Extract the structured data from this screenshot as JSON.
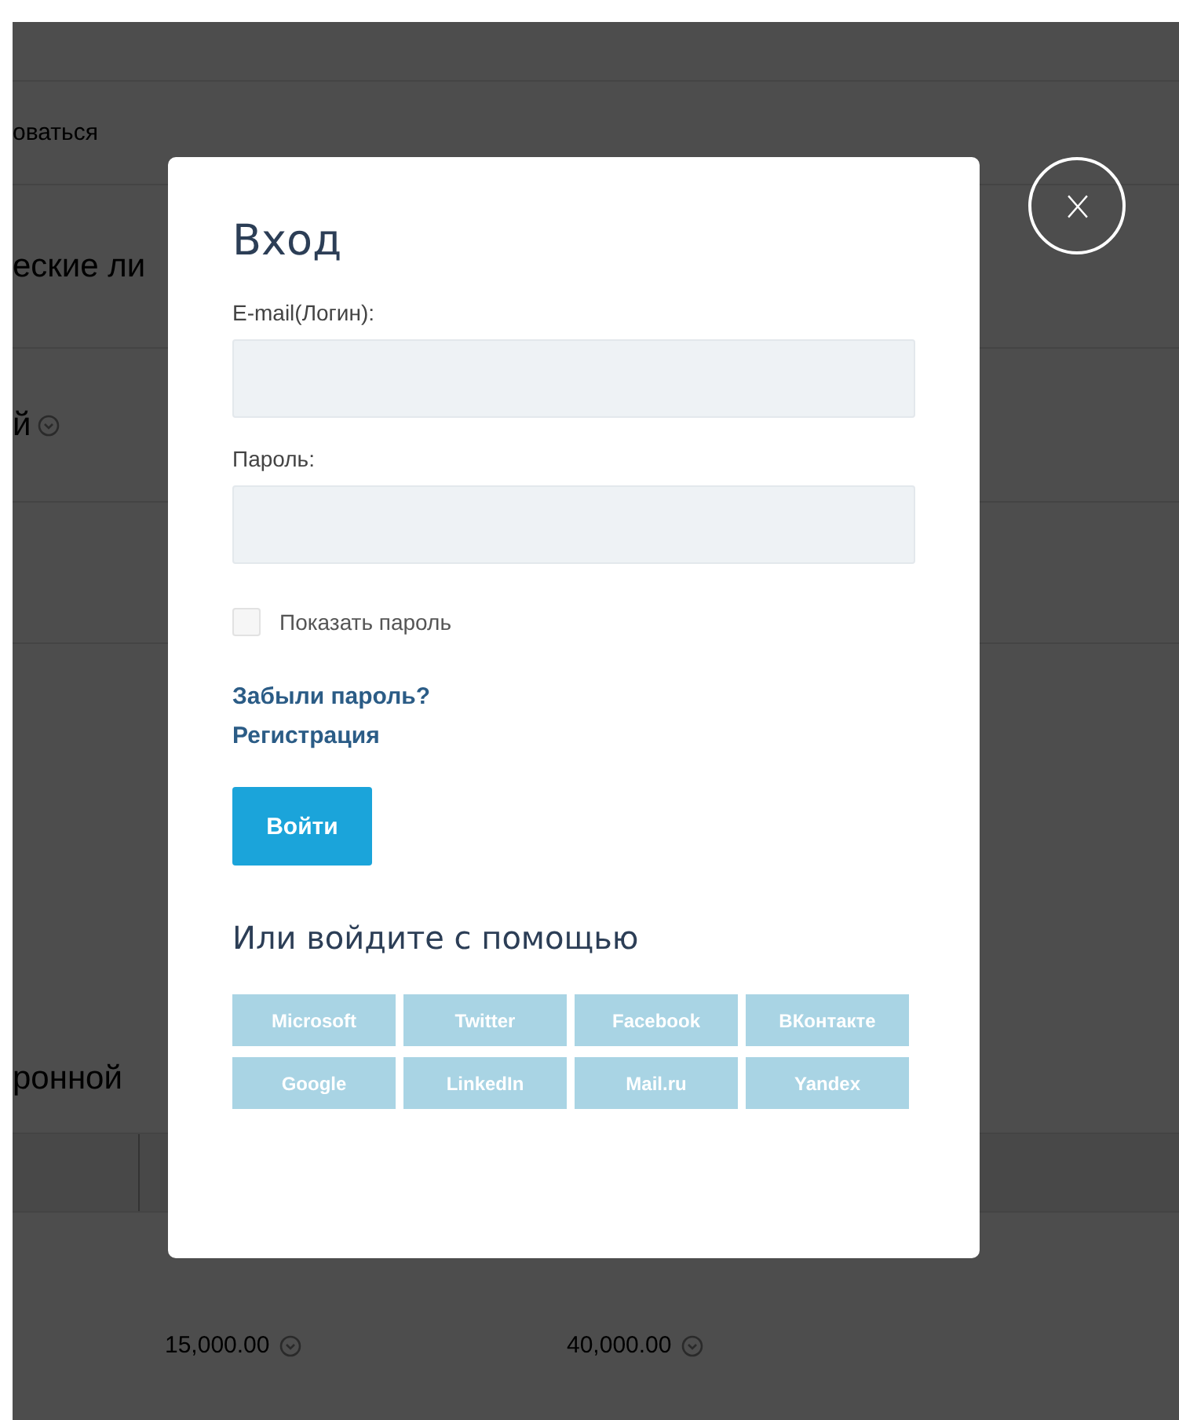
{
  "background": {
    "rows": [
      {
        "text": "оваться",
        "kind": "link"
      },
      {
        "text": "еские ли",
        "kind": "heading"
      },
      {
        "text": "й",
        "kind": "toggle"
      },
      {
        "kind": "blank"
      },
      {
        "text": "ронной",
        "kind": "heading"
      },
      {
        "kind": "table-head"
      },
      {
        "kind": "amounts",
        "amounts": [
          "15,000.00",
          "40,000.00"
        ]
      }
    ]
  },
  "modal": {
    "title": "Вход",
    "fields": [
      {
        "label": "E-mail(Логин):"
      },
      {
        "label": "Пароль:"
      }
    ],
    "show_password": {
      "label": "Показать пароль",
      "checked": false
    },
    "links": [
      "Забыли пароль?",
      "Регистрация"
    ],
    "submit": "Войти",
    "social_heading": "Или войдите с помощью",
    "social": [
      "Microsoft",
      "Twitter",
      "Facebook",
      "ВКонтакте",
      "Google",
      "LinkedIn",
      "Mail.ru",
      "Yandex"
    ]
  }
}
